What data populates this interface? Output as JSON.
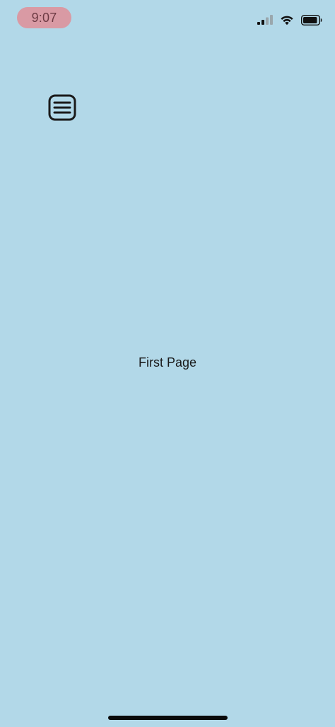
{
  "status_bar": {
    "time": "9:07",
    "time_pill_color": "#d99aa4",
    "signal_icon": "cellular-signal-icon",
    "wifi_icon": "wifi-icon",
    "battery_icon": "battery-icon"
  },
  "header": {
    "menu_icon": "menu-icon"
  },
  "main": {
    "label": "First Page"
  },
  "colors": {
    "background": "#b2d8e8",
    "text": "#1a1a1a"
  }
}
